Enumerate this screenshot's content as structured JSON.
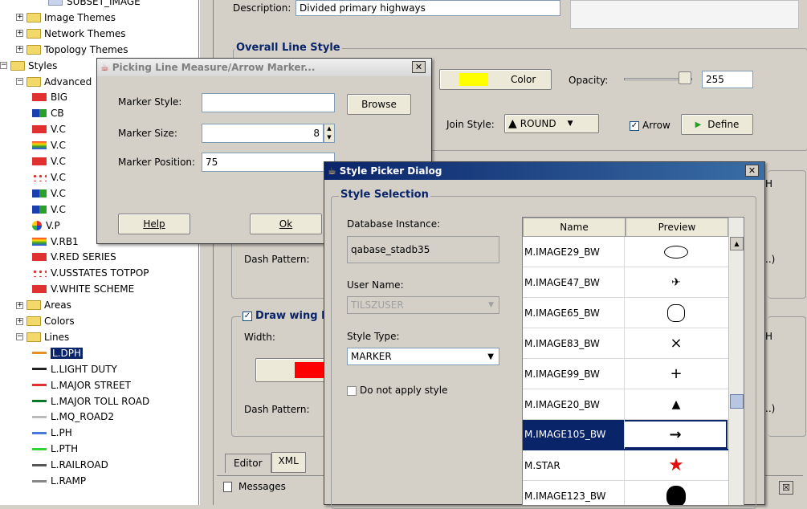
{
  "tree": {
    "items": [
      {
        "label": "SUBSET_IMAGE",
        "kind": "leaf"
      },
      {
        "label": "Image Themes",
        "kind": "folder"
      },
      {
        "label": "Network Themes",
        "kind": "folder"
      },
      {
        "label": "Topology Themes",
        "kind": "folder"
      },
      {
        "label": "Styles",
        "kind": "folder-open"
      },
      {
        "label": "Advanced",
        "kind": "folder-open"
      },
      {
        "label": "BIG",
        "kind": "swatch"
      },
      {
        "label": "CB",
        "kind": "swatch"
      },
      {
        "label": "V.C",
        "kind": "swatch"
      },
      {
        "label": "V.C",
        "kind": "swatch"
      },
      {
        "label": "V.C",
        "kind": "swatch"
      },
      {
        "label": "V.C",
        "kind": "swatch"
      },
      {
        "label": "V.C",
        "kind": "swatch"
      },
      {
        "label": "V.C",
        "kind": "swatch"
      },
      {
        "label": "V.P",
        "kind": "swatch"
      },
      {
        "label": "V.RB1",
        "kind": "swatch"
      },
      {
        "label": "V.RED SERIES",
        "kind": "swatch"
      },
      {
        "label": "V.USSTATES TOTPOP",
        "kind": "swatch"
      },
      {
        "label": "V.WHITE SCHEME",
        "kind": "swatch"
      },
      {
        "label": "Areas",
        "kind": "folder"
      },
      {
        "label": "Colors",
        "kind": "folder"
      },
      {
        "label": "Lines",
        "kind": "folder-open"
      },
      {
        "label": "L.DPH",
        "kind": "line",
        "selected": true
      },
      {
        "label": "L.LIGHT DUTY",
        "kind": "line"
      },
      {
        "label": "L.MAJOR STREET",
        "kind": "line"
      },
      {
        "label": "L.MAJOR TOLL ROAD",
        "kind": "line"
      },
      {
        "label": "L.MQ_ROAD2",
        "kind": "line"
      },
      {
        "label": "L.PH",
        "kind": "line"
      },
      {
        "label": "L.PTH",
        "kind": "line"
      },
      {
        "label": "L.RAILROAD",
        "kind": "line"
      },
      {
        "label": "L.RAMP",
        "kind": "line"
      }
    ]
  },
  "editor": {
    "description_label": "Description:",
    "description_value": "Divided primary highways",
    "overall_line_style": "Overall Line Style",
    "color_button": "Color",
    "opacity_label": "Opacity:",
    "opacity_value": "255",
    "opacity_level": 1.0,
    "join_style_label": "Join Style:",
    "join_style_value": "ROUND",
    "arrow_label": "Arrow",
    "define_button": "Define",
    "dash_pattern_label": "Dash Pattern:",
    "draw_wing_label": "Draw wing l",
    "width_label": "Width:",
    "dash_pattern_label2": "Dash Pattern:",
    "tab_editor": "Editor",
    "tab_xml": "XML",
    "messages_label": "Messages",
    "color_swatch": "#ffff00",
    "wing_color": "#ff0000"
  },
  "marker_dialog": {
    "title": "Picking Line Measure/Arrow Marker...",
    "marker_style_label": "Marker Style:",
    "marker_style_value": "",
    "browse_button": "Browse",
    "marker_size_label": "Marker Size:",
    "marker_size_value": "8",
    "marker_position_label": "Marker Position:",
    "marker_position_value": "75",
    "help_button": "Help",
    "ok_button": "Ok"
  },
  "style_picker": {
    "title": "Style Picker Dialog",
    "section_title": "Style Selection",
    "db_instance_label": "Database Instance:",
    "db_instance_value": "qabase_stadb35",
    "user_name_label": "User Name:",
    "user_name_value": "TILSZUSER",
    "style_type_label": "Style Type:",
    "style_type_value": "MARKER",
    "no_apply_label": "Do not apply style",
    "col_name": "Name",
    "col_preview": "Preview",
    "rows": [
      {
        "name": "M.IMAGE29_BW",
        "preview": "ellipse"
      },
      {
        "name": "M.IMAGE47_BW",
        "preview": "plane"
      },
      {
        "name": "M.IMAGE65_BW",
        "preview": "badge"
      },
      {
        "name": "M.IMAGE83_BW",
        "preview": "×"
      },
      {
        "name": "M.IMAGE99_BW",
        "preview": "+"
      },
      {
        "name": "M.IMAGE20_BW",
        "preview": "▲"
      },
      {
        "name": "M.IMAGE105_BW",
        "preview": "→",
        "selected": true
      },
      {
        "name": "M.STAR",
        "preview": "★"
      },
      {
        "name": "M.IMAGE123_BW",
        "preview": "shield"
      }
    ]
  },
  "right_partial": {
    "text1": "H",
    "text2": "..)",
    "text3": "H",
    "text4": "..)"
  }
}
